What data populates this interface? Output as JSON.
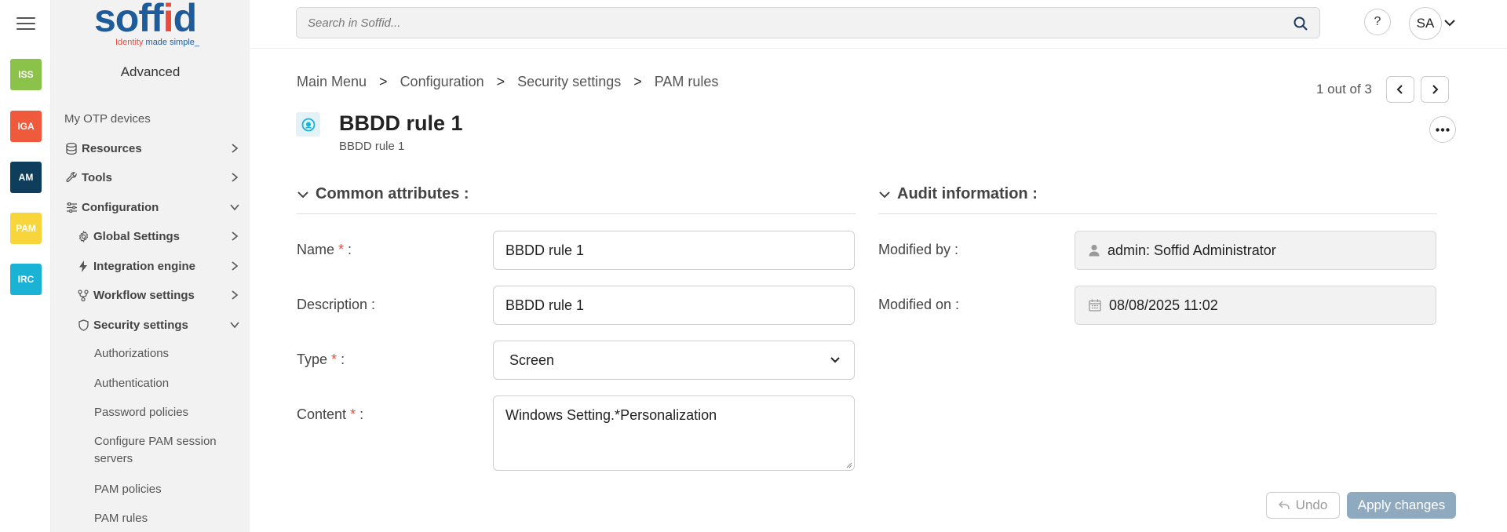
{
  "rail": {
    "apps": [
      {
        "label": "ISS",
        "color": "#8bc34a"
      },
      {
        "label": "IGA",
        "color": "#f05a3c"
      },
      {
        "label": "AM",
        "color": "#0f3d5c"
      },
      {
        "label": "PAM",
        "color": "#f8d53a"
      },
      {
        "label": "IRC",
        "color": "#1ab3d6"
      }
    ]
  },
  "sidebar": {
    "logo_word_start": "soff",
    "logo_word_i": "i",
    "logo_word_end": "d",
    "logo_tag_red": "Identity",
    "logo_tag_blue": " made simple_",
    "profile": "Advanced",
    "items": [
      {
        "label": "My OTP devices",
        "icon": ""
      },
      {
        "label": "Resources",
        "icon": "database-icon"
      },
      {
        "label": "Tools",
        "icon": "wrench-icon"
      },
      {
        "label": "Configuration",
        "icon": "sliders-icon"
      },
      {
        "label": "Global Settings",
        "icon": "gear-icon"
      },
      {
        "label": "Integration engine",
        "icon": "bolt-icon"
      },
      {
        "label": "Workflow settings",
        "icon": "workflow-icon"
      },
      {
        "label": "Security settings",
        "icon": "shield-icon"
      },
      {
        "label": "Authorizations"
      },
      {
        "label": "Authentication"
      },
      {
        "label": "Password policies"
      },
      {
        "label": "Configure PAM session servers"
      },
      {
        "label": "PAM policies"
      },
      {
        "label": "PAM rules"
      }
    ]
  },
  "header": {
    "search_placeholder": "Search in Soffid...",
    "help": "?",
    "avatar": "SA"
  },
  "breadcrumb": [
    "Main Menu",
    "Configuration",
    "Security settings",
    "PAM rules"
  ],
  "breadcrumb_sep": ">",
  "pager": {
    "text": "1 out of 3"
  },
  "title": "BBDD rule 1",
  "subtitle": "BBDD rule 1",
  "sections": {
    "common": {
      "title": "Common attributes :",
      "name_label": "Name",
      "name_value": "BBDD rule 1",
      "description_label": "Description :",
      "description_value": "BBDD rule 1",
      "type_label": "Type",
      "type_value": "Screen",
      "content_label": "Content",
      "content_value": "Windows Setting.*Personalization",
      "required_mark": "*",
      "colon": " :"
    },
    "audit": {
      "title": "Audit information :",
      "modified_by_label": "Modified by :",
      "modified_by_value": "admin: Soffid Administrator",
      "modified_on_label": "Modified on :",
      "modified_on_value": "08/08/2025 11:02"
    }
  },
  "actions": {
    "undo": "Undo",
    "apply": "Apply changes"
  }
}
